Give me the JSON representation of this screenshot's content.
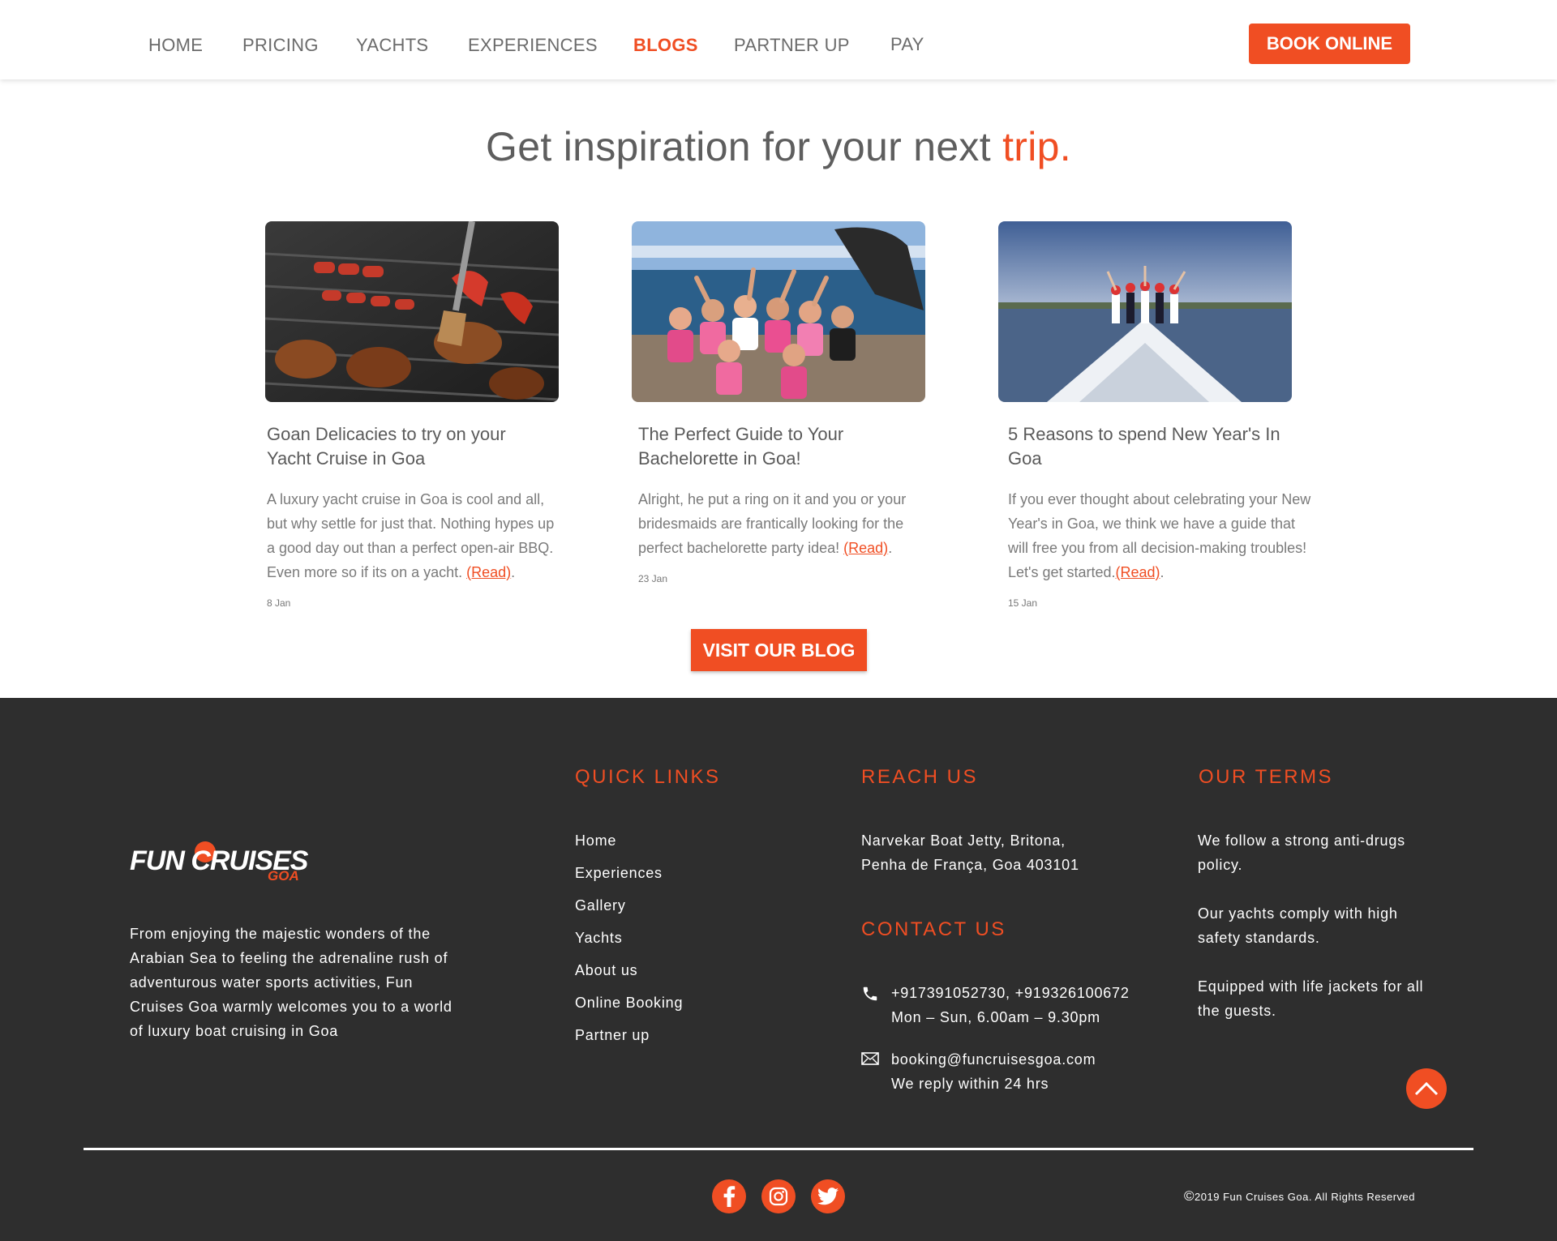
{
  "nav": {
    "items": [
      {
        "label": "HOME",
        "active": false
      },
      {
        "label": "PRICING",
        "active": false
      },
      {
        "label": "YACHTS",
        "active": false
      },
      {
        "label": "EXPERIENCES",
        "active": false
      },
      {
        "label": "BLOGS",
        "active": true
      },
      {
        "label": "PARTNER UP",
        "active": false
      },
      {
        "label": "PAY",
        "active": false
      }
    ],
    "book_label": "BOOK ONLINE"
  },
  "hero": {
    "heading_main": "Get inspiration for your next ",
    "heading_accent": "trip."
  },
  "blogs": [
    {
      "title": "Goan Delicacies to try on your Yacht Cruise in Goa",
      "excerpt": "A luxury yacht cruise in Goa is cool and all, but why settle for just that. Nothing hypes up a good day out than a perfect open-air BBQ. Even more so if its on a yacht. ",
      "read_label": "(Read)",
      "date": "8 Jan",
      "image": "bbq-grill-photo"
    },
    {
      "title": "The Perfect Guide to Your Bachelorette in Goa!",
      "excerpt": "Alright, he put a ring on it and you or your bridesmaids are frantically looking for the perfect bachelorette party idea! ",
      "read_label": "(Read)",
      "date": "23 Jan",
      "image": "bachelorette-party-boat-photo"
    },
    {
      "title": "5 Reasons to spend New Year's In Goa",
      "excerpt": "If you ever thought about celebrating your New Year's in Goa, we think we have a guide that will free you from all decision-making troubles! Let's get started.",
      "read_label": "(Read)",
      "date": "15 Jan",
      "image": "new-year-yacht-deck-photo"
    }
  ],
  "visit_blog_label": "VISIT OUR BLOG",
  "footer": {
    "logo": {
      "fun": "FUN CRUISES",
      "goa": "GOA"
    },
    "about": "From enjoying the majestic wonders of the Arabian Sea to feeling the adrenaline rush of adventurous water sports activities, Fun Cruises Goa warmly welcomes you to a world of luxury boat cruising in Goa",
    "quick_links": {
      "heading": "QUICK LINKS",
      "items": [
        "Home",
        "Experiences",
        "Gallery",
        "Yachts",
        "About us",
        "Online Booking",
        "Partner up"
      ]
    },
    "reach_us": {
      "heading": "REACH US",
      "line1": "Narvekar Boat Jetty, Britona,",
      "line2": "Penha de França, Goa 403101"
    },
    "contact_us": {
      "heading": "CONTACT US",
      "phone": "+917391052730, +919326100672",
      "hours": "Mon – Sun, 6.00am – 9.30pm",
      "email": "booking@funcruisesgoa.com",
      "reply": "We reply within 24 hrs"
    },
    "terms": {
      "heading": "OUR TERMS",
      "items": [
        "We follow a strong anti-drugs policy.",
        "Our yachts comply with high safety standards.",
        "Equipped with life jackets for all the guests."
      ]
    },
    "social": [
      "facebook-icon",
      "instagram-icon",
      "twitter-icon"
    ],
    "copyright_symbol": "©",
    "copyright": "2019 Fun Cruises Goa. All Rights Reserved"
  },
  "colors": {
    "accent": "#f04e23",
    "footer_bg": "#2e2e2e"
  }
}
